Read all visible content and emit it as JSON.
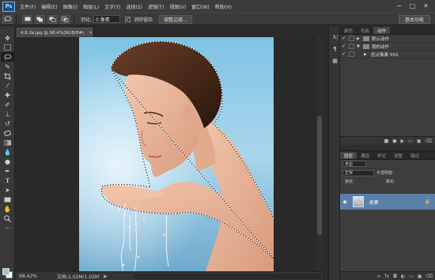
{
  "app": {
    "logo": "Ps"
  },
  "menu": [
    "文件(F)",
    "编辑(E)",
    "图像(I)",
    "图层(L)",
    "文字(Y)",
    "选择(S)",
    "滤镜(T)",
    "视图(V)",
    "窗口(W)",
    "帮助(H)"
  ],
  "window_controls": {
    "minimize": "−",
    "maximize": "□",
    "close": "✕"
  },
  "options": {
    "feather_label": "羽化:",
    "feather_value": "0 像素",
    "antialias_label": "消除锯齿",
    "antialias_checked": "✓",
    "refine_edge_button": "调整边缘...",
    "workspace_button": "基本功能"
  },
  "document": {
    "tab_title": "4.6.2a.jpg @ 98.4%(RGB/8#)",
    "tab_close": "×",
    "zoom": "98.42%",
    "doc_info": "文档:1.02M/1.02M",
    "status_arrow": "▶"
  },
  "actions_panel": {
    "tabs": [
      "颜色",
      "色板",
      "动作"
    ],
    "active_tab": "动作",
    "rows": [
      {
        "label": "默认动作",
        "level": 0,
        "type": "set",
        "tri": "▶"
      },
      {
        "label": "我的动作",
        "level": 0,
        "type": "set",
        "tri": "▼"
      },
      {
        "label": "控点像素 550",
        "level": 1,
        "type": "action",
        "tri": "▶"
      }
    ],
    "check": "✓"
  },
  "layers_panel": {
    "tabs": [
      "图层",
      "通道",
      "样式",
      "调整",
      "路径"
    ],
    "active_tab": "图层",
    "filter_label": "类型",
    "blend_mode": "正常",
    "opacity_label": "不透明度:",
    "lock_label": "锁定:",
    "fill_label": "填充:",
    "layer_name": "背景",
    "lock_icon": "🔒"
  },
  "colors": {
    "foreground": "#9bc3dc",
    "background": "#ffffff",
    "layer_selected": "#5a7fa8"
  }
}
